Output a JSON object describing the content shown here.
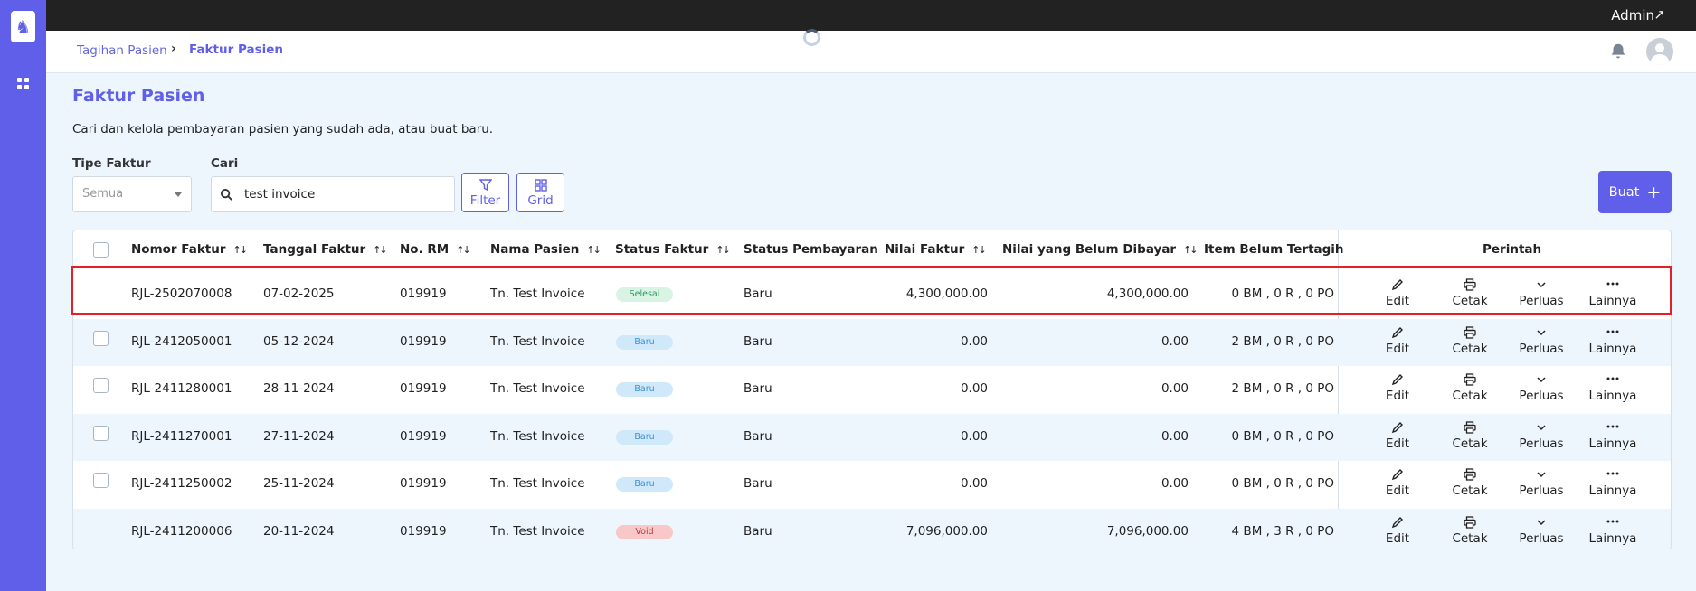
{
  "topbar": {
    "user": "Admin",
    "external_icon": "external-link-icon"
  },
  "breadcrumb": {
    "parent": "Tagihan Pasien",
    "current": "Faktur Pasien"
  },
  "page": {
    "title": "Faktur Pasien",
    "description": "Cari dan kelola pembayaran pasien yang sudah ada, atau buat baru."
  },
  "filters": {
    "tipe_label": "Tipe Faktur",
    "tipe_value": "Semua",
    "cari_label": "Cari",
    "search_value": "test invoice",
    "filter_label": "Filter",
    "grid_label": "Grid",
    "create_label": "Buat"
  },
  "table": {
    "headers": {
      "nomor": "Nomor Faktur",
      "tanggal": "Tanggal Faktur",
      "rm": "No. RM",
      "nama": "Nama Pasien",
      "status_faktur": "Status Faktur",
      "status_pembayaran": "Status Pembayaran",
      "nilai": "Nilai Faktur",
      "belum_dibayar": "Nilai yang Belum Dibayar",
      "item": "Item Belum Tertagih",
      "perintah": "Perintah"
    },
    "actions": {
      "edit": "Edit",
      "cetak": "Cetak",
      "perluas": "Perluas",
      "lainnya": "Lainnya"
    },
    "rows": [
      {
        "nomor": "RJL-2502070008",
        "tanggal": "07-02-2025",
        "rm": "019919",
        "nama": "Tn. Test Invoice",
        "status": "Selesai",
        "status_color": "#2f9a5c",
        "pembayaran": "Baru",
        "nilai": "4,300,000.00",
        "belum": "4,300,000.00",
        "item": "0 BM , 0 R , 0 PO",
        "checkbox": false
      },
      {
        "nomor": "RJL-2412050001",
        "tanggal": "05-12-2024",
        "rm": "019919",
        "nama": "Tn. Test Invoice",
        "status": "Baru",
        "status_color": "#3e8fcc",
        "pembayaran": "Baru",
        "nilai": "0.00",
        "belum": "0.00",
        "item": "2 BM , 0 R , 0 PO",
        "checkbox": true
      },
      {
        "nomor": "RJL-2411280001",
        "tanggal": "28-11-2024",
        "rm": "019919",
        "nama": "Tn. Test Invoice",
        "status": "Baru",
        "status_color": "#3e8fcc",
        "pembayaran": "Baru",
        "nilai": "0.00",
        "belum": "0.00",
        "item": "2 BM , 0 R , 0 PO",
        "checkbox": true
      },
      {
        "nomor": "RJL-2411270001",
        "tanggal": "27-11-2024",
        "rm": "019919",
        "nama": "Tn. Test Invoice",
        "status": "Baru",
        "status_color": "#3e8fcc",
        "pembayaran": "Baru",
        "nilai": "0.00",
        "belum": "0.00",
        "item": "0 BM , 0 R , 0 PO",
        "checkbox": true
      },
      {
        "nomor": "RJL-2411250002",
        "tanggal": "25-11-2024",
        "rm": "019919",
        "nama": "Tn. Test Invoice",
        "status": "Baru",
        "status_color": "#3e8fcc",
        "pembayaran": "Baru",
        "nilai": "0.00",
        "belum": "0.00",
        "item": "0 BM , 0 R , 0 PO",
        "checkbox": true
      },
      {
        "nomor": "RJL-2411200006",
        "tanggal": "20-11-2024",
        "rm": "019919",
        "nama": "Tn. Test Invoice",
        "status": "Void",
        "status_color": "#b53b3e",
        "pembayaran": "Baru",
        "nilai": "7,096,000.00",
        "belum": "7,096,000.00",
        "item": "4 BM , 3 R , 0 PO",
        "checkbox": false
      }
    ]
  },
  "colors": {
    "brand": "#5f5fe9",
    "highlight": "#e41f26"
  }
}
